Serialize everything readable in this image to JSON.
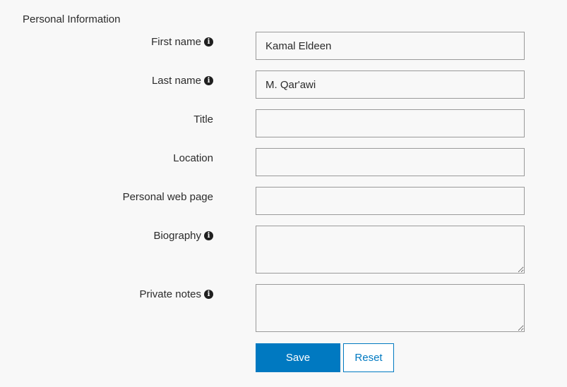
{
  "section": {
    "title": "Personal Information"
  },
  "fields": {
    "first_name": {
      "label": "First name",
      "value": "Kamal Eldeen",
      "has_info": true
    },
    "last_name": {
      "label": "Last name",
      "value": "M. Qar'awi",
      "has_info": true
    },
    "title": {
      "label": "Title",
      "value": ""
    },
    "location": {
      "label": "Location",
      "value": ""
    },
    "web_page": {
      "label": "Personal web page",
      "value": ""
    },
    "biography": {
      "label": "Biography",
      "value": "",
      "has_info": true
    },
    "private_notes": {
      "label": "Private notes",
      "value": "",
      "has_info": true
    }
  },
  "buttons": {
    "save": "Save",
    "reset": "Reset"
  },
  "icons": {
    "info": "info-circle-icon"
  },
  "colors": {
    "accent": "#0079c1",
    "background": "#f8f8f8",
    "border": "#9a9a9a"
  }
}
